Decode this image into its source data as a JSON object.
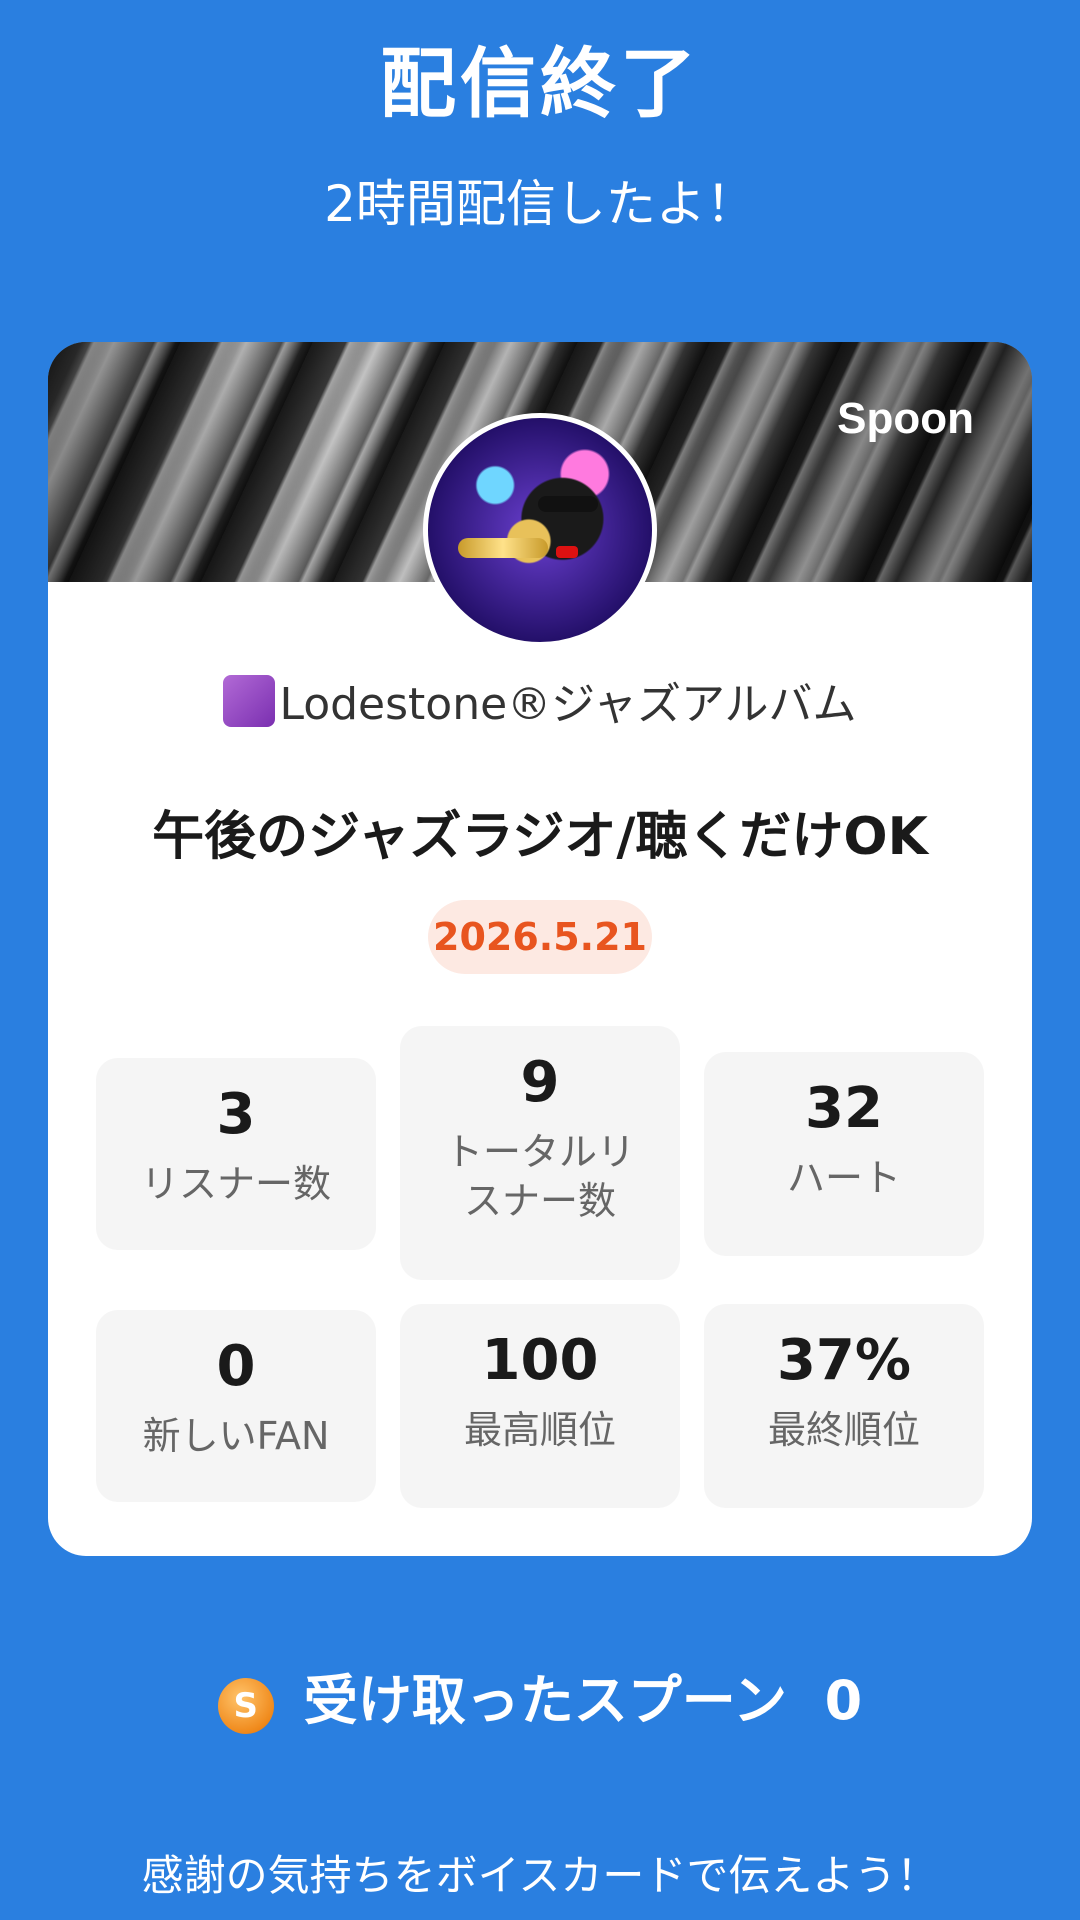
{
  "header": {
    "title": "配信終了",
    "subtitle": "2時間配信したよ！"
  },
  "card": {
    "brand": "Spoon",
    "channel_name": "Lodestone®ジャズアルバム",
    "live_title": "午後のジャズラジオ/聴くだけOK",
    "date": "2026.5.21",
    "stats": [
      {
        "value": "3",
        "label": "リスナー数"
      },
      {
        "value": "9",
        "label": "トータルリスナー数"
      },
      {
        "value": "32",
        "label": "ハート"
      },
      {
        "value": "0",
        "label": "新しいFAN"
      },
      {
        "value": "100",
        "label": "最高順位"
      },
      {
        "value": "37%",
        "label": "最終順位"
      }
    ]
  },
  "spoons": {
    "icon_letter": "S",
    "label": "受け取ったスプーン",
    "count": "0"
  },
  "footer": {
    "message": "感謝の気持ちをボイスカードで伝えよう！"
  }
}
